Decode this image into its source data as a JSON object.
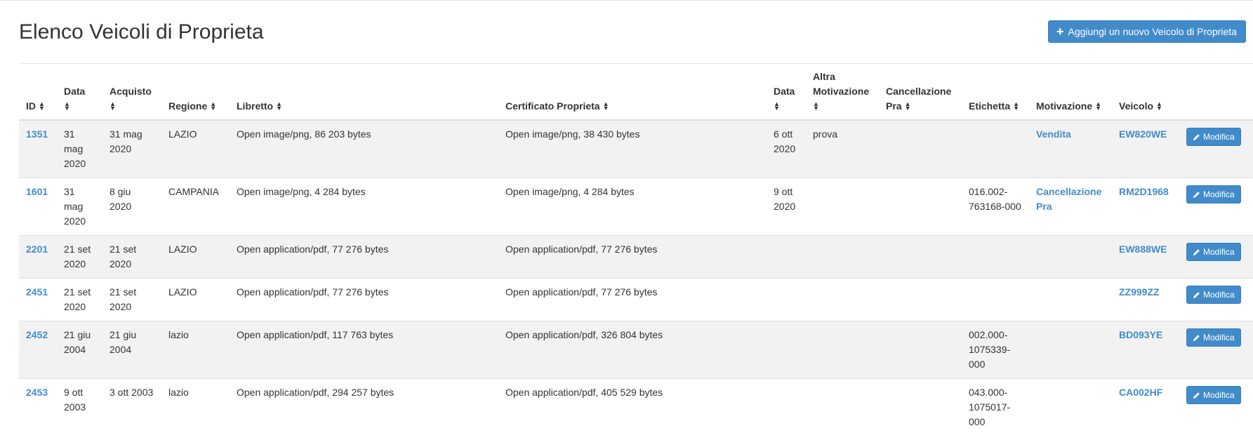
{
  "page": {
    "title": "Elenco Veicoli di Proprieta",
    "add_button_label": "Aggiungi un nuovo Veicolo di Proprieta",
    "add_button_icon": "plus-icon"
  },
  "colors": {
    "accent": "#428bca",
    "stripe": "#f2f2f2"
  },
  "table": {
    "headers": {
      "id": "ID",
      "data": "Data",
      "acquisto": "Acquisto",
      "regione": "Regione",
      "libretto": "Libretto",
      "certificato": "Certificato Proprieta",
      "data2": "Data",
      "altra_motivazione": "Altra Motivazione",
      "cancellazione_pra": "Cancellazione Pra",
      "etichetta": "Etichetta",
      "motivazione": "Motivazione",
      "veicolo": "Veicolo"
    },
    "edit_label": "Modifica",
    "rows": [
      {
        "id": "1351",
        "data": "31 mag 2020",
        "acquisto": "31 mag 2020",
        "regione": "LAZIO",
        "libretto": "Open image/png, 86 203 bytes",
        "certificato": "Open image/png, 38 430 bytes",
        "data2": "6 ott 2020",
        "altra_motivazione": "prova",
        "cancellazione_pra": "",
        "etichetta": "",
        "motivazione": "Vendita",
        "veicolo": "EW820WE"
      },
      {
        "id": "1601",
        "data": "31 mag 2020",
        "acquisto": "8 giu 2020",
        "regione": "CAMPANIA",
        "libretto": "Open image/png, 4 284 bytes",
        "certificato": "Open image/png, 4 284 bytes",
        "data2": "9 ott 2020",
        "altra_motivazione": "",
        "cancellazione_pra": "",
        "etichetta": "016.002-763168-000",
        "motivazione": "Cancellazione Pra",
        "veicolo": "RM2D1968"
      },
      {
        "id": "2201",
        "data": "21 set 2020",
        "acquisto": "21 set 2020",
        "regione": "LAZIO",
        "libretto": "Open application/pdf, 77 276 bytes",
        "certificato": "Open application/pdf, 77 276 bytes",
        "data2": "",
        "altra_motivazione": "",
        "cancellazione_pra": "",
        "etichetta": "",
        "motivazione": "",
        "veicolo": "EW888WE"
      },
      {
        "id": "2451",
        "data": "21 set 2020",
        "acquisto": "21 set 2020",
        "regione": "LAZIO",
        "libretto": "Open application/pdf, 77 276 bytes",
        "certificato": "Open application/pdf, 77 276 bytes",
        "data2": "",
        "altra_motivazione": "",
        "cancellazione_pra": "",
        "etichetta": "",
        "motivazione": "",
        "veicolo": "ZZ999ZZ"
      },
      {
        "id": "2452",
        "data": "21 giu 2004",
        "acquisto": "21 giu 2004",
        "regione": "lazio",
        "libretto": "Open application/pdf, 117 763 bytes",
        "certificato": "Open application/pdf, 326 804 bytes",
        "data2": "",
        "altra_motivazione": "",
        "cancellazione_pra": "",
        "etichetta": "002.000-1075339-000",
        "motivazione": "",
        "veicolo": "BD093YE"
      },
      {
        "id": "2453",
        "data": "9 ott 2003",
        "acquisto": "3 ott 2003",
        "regione": "lazio",
        "libretto": "Open application/pdf, 294 257 bytes",
        "certificato": "Open application/pdf, 405 529 bytes",
        "data2": "",
        "altra_motivazione": "",
        "cancellazione_pra": "",
        "etichetta": "043.000-1075017-000",
        "motivazione": "",
        "veicolo": "CA002HF"
      }
    ]
  }
}
